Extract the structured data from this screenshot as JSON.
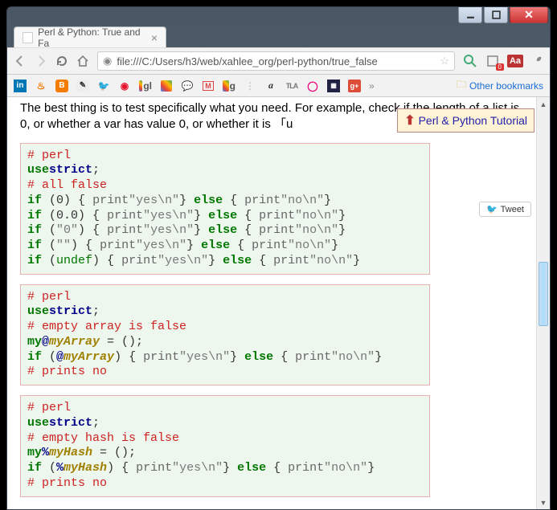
{
  "tab": {
    "title": "Perl & Python: True and Fa"
  },
  "url": "file:///C:/Users/h3/web/xahlee_org/perl-python/true_false",
  "bookmarks": {
    "other_label": "Other bookmarks"
  },
  "badge_dl": "0",
  "navbox": {
    "label": "Perl & Python Tutorial"
  },
  "tweet": {
    "label": "Tweet"
  },
  "body_para": "The best thing is to test specifically what you need. For example, check if the length of a list is 0, or whether a var has value 0, or whether it is 「u",
  "code1": {
    "l1_cmt": "# perl",
    "l2_use": "use",
    "l2_strict": "strict",
    "l2_semi": ";",
    "l3_cmt": "# all false",
    "l4": {
      "if": "if",
      "op": " (",
      "v": "0",
      "cp": ") { ",
      "p1": "print",
      "s1": "\"yes\\n\"",
      "cb": "} ",
      "el": "else",
      "ob": " { ",
      "p2": "print",
      "s2": "\"no\\n\"",
      "end": "}"
    },
    "l5": {
      "if": "if",
      "op": " (",
      "v": "0.0",
      "cp": ") { ",
      "p1": "print",
      "s1": "\"yes\\n\"",
      "cb": "} ",
      "el": "else",
      "ob": " { ",
      "p2": "print",
      "s2": "\"no\\n\"",
      "end": "}"
    },
    "l6": {
      "if": "if",
      "op": " (",
      "v": "\"0\"",
      "cp": ") { ",
      "p1": "print",
      "s1": "\"yes\\n\"",
      "cb": "} ",
      "el": "else",
      "ob": " { ",
      "p2": "print",
      "s2": "\"no\\n\"",
      "end": "}"
    },
    "l7": {
      "if": "if",
      "op": " (",
      "v": "\"\"",
      "cp": ") { ",
      "p1": "print",
      "s1": "\"yes\\n\"",
      "cb": "} ",
      "el": "else",
      "ob": " { ",
      "p2": "print",
      "s2": "\"no\\n\"",
      "end": "}"
    },
    "l8": {
      "if": "if",
      "op": " (",
      "v": "undef",
      "cp": ") { ",
      "p1": "print",
      "s1": "\"yes\\n\"",
      "cb": "} ",
      "el": "else",
      "ob": " { ",
      "p2": "print",
      "s2": "\"no\\n\"",
      "end": "}"
    }
  },
  "code2": {
    "l1_cmt": "# perl",
    "l2_use": "use",
    "l2_strict": "strict",
    "l2_semi": ";",
    "l3_cmt": "# empty array is false",
    "l4_my": "my",
    "l4_sig": "@",
    "l4_var": "myArray",
    "l4_rest": " = ();",
    "l5": {
      "if": "if",
      "op": " (",
      "sig": "@",
      "var": "myArray",
      "cp": ") { ",
      "p1": "print",
      "s1": "\"yes\\n\"",
      "cb": "} ",
      "el": "else",
      "ob": " { ",
      "p2": "print",
      "s2": "\"no\\n\"",
      "end": "}"
    },
    "l6_cmt": "# prints no"
  },
  "code3": {
    "l1_cmt": "# perl",
    "l2_use": "use",
    "l2_strict": "strict",
    "l2_semi": ";",
    "l3_cmt": "# empty hash is false",
    "l4_my": "my",
    "l4_sig": "%",
    "l4_var": "myHash",
    "l4_rest": " = ();",
    "l5": {
      "if": "if",
      "op": " (",
      "sig": "%",
      "var": "myHash",
      "cp": ") { ",
      "p1": "print",
      "s1": "\"yes\\n\"",
      "cb": "} ",
      "el": "else",
      "ob": " { ",
      "p2": "print",
      "s2": "\"no\\n\"",
      "end": "}"
    },
    "l6_cmt": "# prints no"
  }
}
